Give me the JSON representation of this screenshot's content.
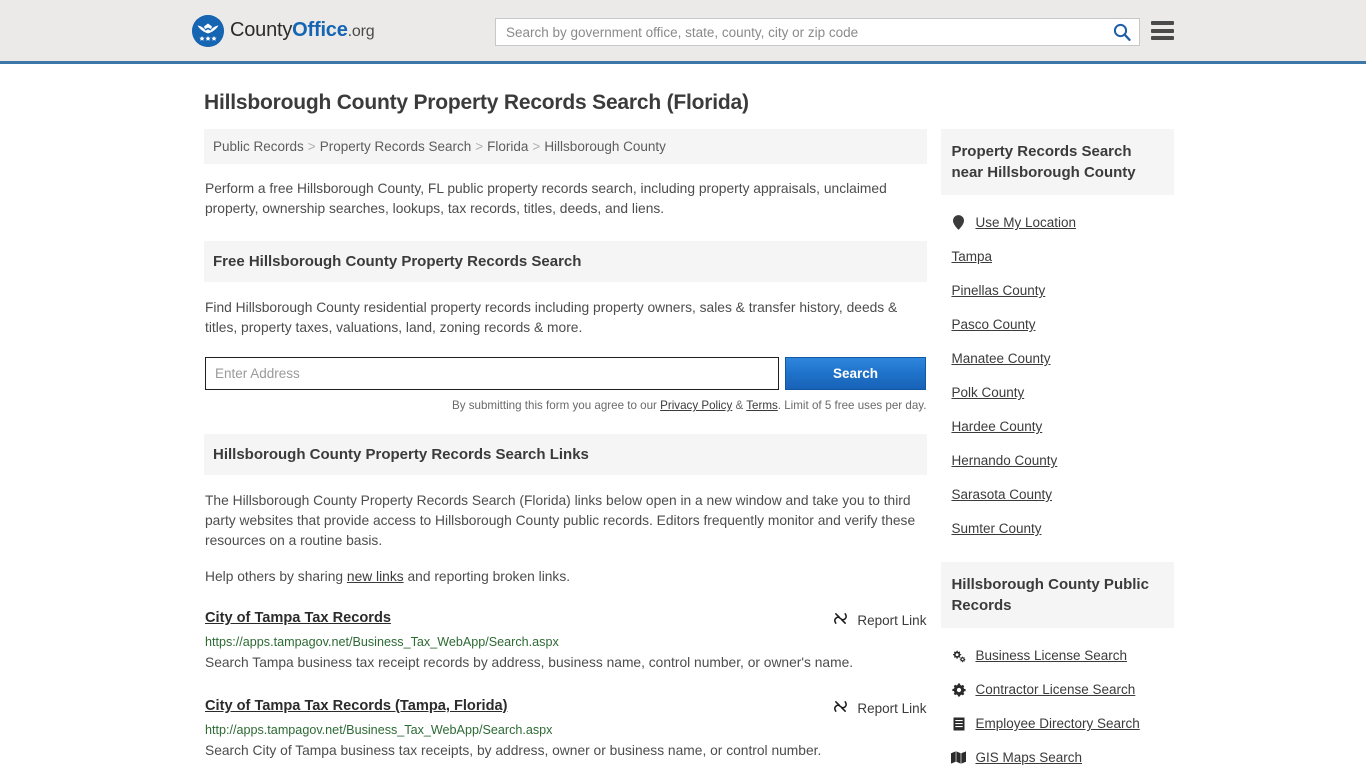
{
  "header": {
    "logo_text_county": "County",
    "logo_text_office": "Office",
    "logo_text_org": ".org",
    "search_placeholder": "Search by government office, state, county, city or zip code",
    "search_value": "",
    "search_icon": "search-icon",
    "menu_icon": "hamburger-menu-icon",
    "accent_color": "#3d77a8"
  },
  "main": {
    "title": "Hillsborough County Property Records Search (Florida)",
    "breadcrumb": [
      "Public Records",
      "Property Records Search",
      "Florida",
      "Hillsborough County"
    ],
    "breadcrumb_separator": ">",
    "intro": "Perform a free Hillsborough County, FL public property records search, including property appraisals, unclaimed property, ownership searches, lookups, tax records, titles, deeds, and liens.",
    "free_search": {
      "heading": "Free Hillsborough County Property Records Search",
      "description": "Find Hillsborough County residential property records including property owners, sales & transfer history, deeds & titles, property taxes, valuations, land, zoning records & more.",
      "input_placeholder": "Enter Address",
      "input_value": "",
      "button_label": "Search",
      "disclaimer_pre": "By submitting this form you agree to our ",
      "disclaimer_privacy": "Privacy Policy",
      "disclaimer_amp": " & ",
      "disclaimer_terms": "Terms",
      "disclaimer_post": ". Limit of 5 free uses per day."
    },
    "links_section": {
      "heading": "Hillsborough County Property Records Search Links",
      "paragraph": "The Hillsborough County Property Records Search (Florida) links below open in a new window and take you to third party websites that provide access to Hillsborough County public records. Editors frequently monitor and verify these resources on a routine basis.",
      "help_pre": "Help others by sharing ",
      "help_link": "new links",
      "help_post": " and reporting broken links.",
      "report_label": "Report Link",
      "report_icon": "broken-link-icon",
      "items": [
        {
          "title": "City of Tampa Tax Records",
          "url": "https://apps.tampagov.net/Business_Tax_WebApp/Search.aspx",
          "description": "Search Tampa business tax receipt records by address, business name, control number, or owner's name."
        },
        {
          "title": "City of Tampa Tax Records (Tampa, Florida)",
          "url": "http://apps.tampagov.net/Business_Tax_WebApp/Search.aspx",
          "description": "Search City of Tampa business tax receipts, by address, owner or business name, or control number."
        }
      ]
    }
  },
  "sidebar": {
    "nearby": {
      "heading": "Property Records Search near Hillsborough County",
      "items": [
        {
          "label": "Use My Location",
          "icon": "map-pin-icon"
        },
        {
          "label": "Tampa",
          "icon": ""
        },
        {
          "label": "Pinellas County",
          "icon": ""
        },
        {
          "label": "Pasco County",
          "icon": ""
        },
        {
          "label": "Manatee County",
          "icon": ""
        },
        {
          "label": "Polk County",
          "icon": ""
        },
        {
          "label": "Hardee County",
          "icon": ""
        },
        {
          "label": "Hernando County",
          "icon": ""
        },
        {
          "label": "Sarasota County",
          "icon": ""
        },
        {
          "label": "Sumter County",
          "icon": ""
        }
      ]
    },
    "public_records": {
      "heading": "Hillsborough County Public Records",
      "items": [
        {
          "label": "Business License Search",
          "icon": "cogs-icon"
        },
        {
          "label": "Contractor License Search",
          "icon": "cog-icon"
        },
        {
          "label": "Employee Directory Search",
          "icon": "list-icon"
        },
        {
          "label": "GIS Maps Search",
          "icon": "map-icon"
        }
      ]
    }
  }
}
